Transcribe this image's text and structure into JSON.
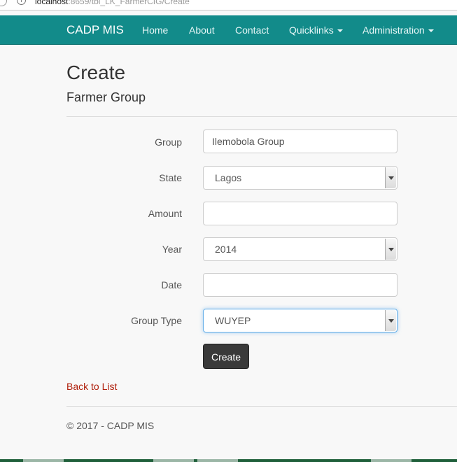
{
  "browser": {
    "url_host": "localhost",
    "url_rest": ":8659/tbl_LK_FarmerCIG/Create"
  },
  "navbar": {
    "brand": "CADP MIS",
    "items": [
      {
        "label": "Home"
      },
      {
        "label": "About"
      },
      {
        "label": "Contact"
      },
      {
        "label": "Quicklinks",
        "dropdown": true
      },
      {
        "label": "Administration",
        "dropdown": true
      }
    ]
  },
  "page": {
    "title": "Create",
    "subtitle": "Farmer Group"
  },
  "form": {
    "fields": [
      {
        "label": "Group",
        "type": "text",
        "value": "Ilemobola Group"
      },
      {
        "label": "State",
        "type": "select",
        "value": "Lagos"
      },
      {
        "label": "Amount",
        "type": "text",
        "value": ""
      },
      {
        "label": "Year",
        "type": "select",
        "value": "2014"
      },
      {
        "label": "Date",
        "type": "text",
        "value": ""
      },
      {
        "label": "Group Type",
        "type": "select",
        "value": "WUYEP",
        "focused": true
      }
    ],
    "submit_label": "Create"
  },
  "back_link": "Back to List",
  "footer": "© 2017 - CADP MIS",
  "colors": {
    "navbar": "#128b8a",
    "link": "#b0200c",
    "button": "#3a3a3a"
  }
}
